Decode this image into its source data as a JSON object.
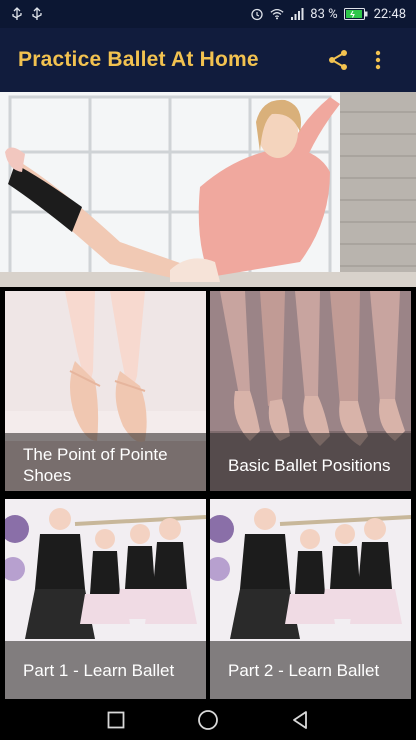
{
  "status_bar": {
    "battery_percent": "83 %",
    "time": "22:48",
    "icons": [
      "usb-icon",
      "usb-icon",
      "alarm-icon",
      "wifi-icon",
      "signal-icon",
      "battery-icon"
    ]
  },
  "app_bar": {
    "title": "Practice Ballet At Home",
    "actions": [
      "share-icon",
      "more-vert-icon"
    ]
  },
  "colors": {
    "status_bar_bg": "#0c1733",
    "app_bar_bg": "#111c3d",
    "title_color": "#f2c250",
    "caption_overlay": "rgba(60,55,55,0.62)"
  },
  "tiles": [
    {
      "caption": "The Point of Pointe Shoes"
    },
    {
      "caption": "Basic Ballet Positions"
    },
    {
      "caption": "Part 1 - Learn Ballet"
    },
    {
      "caption": "Part 2 - Learn Ballet"
    }
  ],
  "nav_bar": {
    "buttons": [
      "recents-square-icon",
      "home-circle-icon",
      "back-triangle-icon"
    ]
  }
}
